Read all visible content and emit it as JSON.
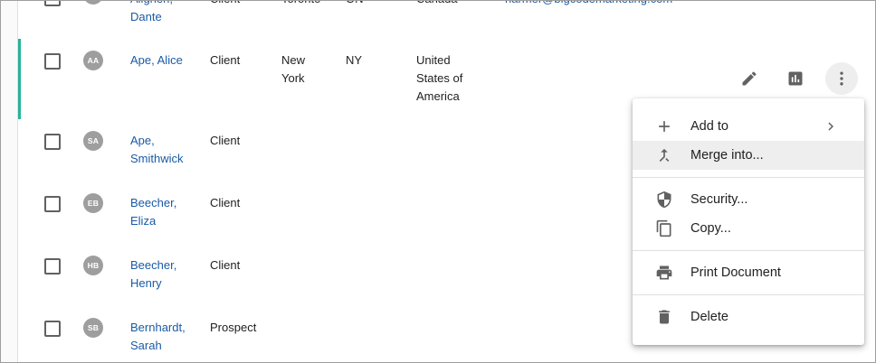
{
  "rows": [
    {
      "initials": "",
      "name_line1": "Aligheri,",
      "name_line2": "Dante",
      "type": "Client",
      "city": "Toronto",
      "state": "ON",
      "country": "Canada",
      "email": "narmer@bigcodemarketing.com"
    },
    {
      "initials": "AA",
      "name_line1": "Ape, Alice",
      "name_line2": "",
      "type": "Client",
      "city_line1": "New",
      "city_line2": "York",
      "state": "NY",
      "country_line1": "United",
      "country_line2": "States of",
      "country_line3": "America"
    },
    {
      "initials": "SA",
      "name_line1": "Ape,",
      "name_line2": "Smithwick",
      "type": "Client"
    },
    {
      "initials": "EB",
      "name_line1": "Beecher,",
      "name_line2": "Eliza",
      "type": "Client"
    },
    {
      "initials": "HB",
      "name_line1": "Beecher,",
      "name_line2": "Henry",
      "type": "Client"
    },
    {
      "initials": "SB",
      "name_line1": "Bernhardt,",
      "name_line2": "Sarah",
      "type": "Prospect"
    }
  ],
  "row_actions": {
    "edit_icon": "pencil-icon",
    "chart_icon": "bar-chart-icon",
    "more_icon": "more-vert-icon"
  },
  "context_menu": {
    "add_to": "Add to",
    "merge_into": "Merge into...",
    "security": "Security...",
    "copy": "Copy...",
    "print_document": "Print Document",
    "delete": "Delete"
  },
  "colors": {
    "accent": "#26b39a",
    "link": "#1a5aa6",
    "avatar": "#9e9e9e",
    "icon": "#616161"
  }
}
